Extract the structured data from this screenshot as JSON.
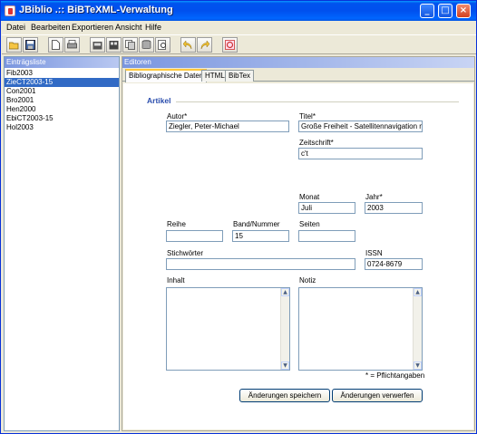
{
  "window": {
    "title": "JBiblio .:: BiBTeXML-Verwaltung",
    "minimize": "_",
    "maximize": "□",
    "close": "×"
  },
  "menu": [
    "Datei",
    "Bearbeiten",
    "Exportieren",
    "Ansicht",
    "Hilfe"
  ],
  "toolbar": {
    "icons": [
      "open-icon",
      "save-icon",
      "new-document-icon",
      "print-icon",
      "export-icon",
      "export-all-icon",
      "copy-icon",
      "database-icon",
      "preview-icon",
      "undo-icon",
      "redo-icon",
      "exit-icon"
    ]
  },
  "entries": {
    "header": "Einträgsliste",
    "items": [
      "Fib2003",
      "ZieCT2003-15",
      "Con2001",
      "Bro2001",
      "Hen2000",
      "EbiCT2003-15",
      "Hol2003"
    ],
    "selected_index": 1
  },
  "editor": {
    "header": "Editoren",
    "tabs": [
      "Bibliographische Daten",
      "HTML",
      "BibTex"
    ],
    "active_tab": 0,
    "group": "Artikel",
    "labels": {
      "autor": "Autor*",
      "titel": "Titel*",
      "zeitschrift": "Zeitschrift*",
      "monat": "Monat",
      "jahr": "Jahr*",
      "reihe": "Reihe",
      "band": "Band/Nummer",
      "seiten": "Seiten",
      "stichwoerter": "Stichwörter",
      "issn": "ISSN",
      "inhalt": "Inhalt",
      "notiz": "Notiz",
      "required": "* = Pflichtangaben"
    },
    "values": {
      "autor": "Ziegler, Peter-Michael",
      "titel": "Große Freiheit - Satellitennavigation mit",
      "zeitschrift": "c't",
      "monat": "Juli",
      "jahr": "2003",
      "reihe": "",
      "band": "15",
      "seiten": "",
      "stichwoerter": "",
      "issn": "0724-8679"
    },
    "buttons": {
      "save": "Änderungen speichern",
      "discard": "Änderungen verwerfen"
    }
  }
}
